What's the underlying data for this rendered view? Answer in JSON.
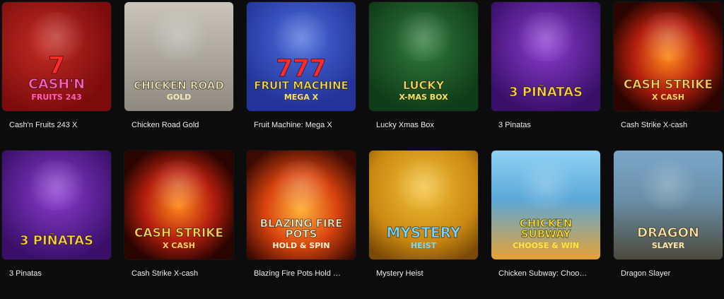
{
  "games": [
    {
      "title": "Cash'n Fruits 243 X",
      "art_text": [
        "7",
        "Cash'n",
        "Fruits 243"
      ],
      "icon": "slot-seven-fruit-art",
      "theme": "t-cash243",
      "text_color": "#ff5fb8",
      "text_size": 19
    },
    {
      "title": "Chicken Road Gold",
      "art_text": [
        "",
        "Chicken Road",
        "Gold"
      ],
      "icon": "chicken-mascot-art",
      "theme": "t-chicken",
      "text_color": "#f4e6b8",
      "text_size": 15
    },
    {
      "title": "Fruit Machine: Mega X",
      "art_text": [
        "777",
        "Fruit Machine",
        "Mega X"
      ],
      "icon": "fruit-machine-art",
      "theme": "t-fruitmx",
      "text_color": "#ffe04a",
      "text_size": 15
    },
    {
      "title": "Lucky Xmas Box",
      "art_text": [
        "",
        "Lucky",
        "X-Mas Box"
      ],
      "icon": "santa-art",
      "theme": "t-xmas",
      "text_color": "#ffdc5a",
      "text_size": 16
    },
    {
      "title": "3 Pinatas",
      "art_text": [
        "",
        "3 Piñatas",
        ""
      ],
      "icon": "pinata-cactus-art",
      "theme": "t-pinatas",
      "text_color": "#ffd23a",
      "text_size": 18
    },
    {
      "title": "Cash Strike X-cash",
      "art_text": [
        "",
        "Cash Strike",
        "X Cash"
      ],
      "icon": "cash-strike-art",
      "theme": "t-cashstrike",
      "text_color": "#ffd35a",
      "text_size": 17
    },
    {
      "title": "3 Pinatas",
      "art_text": [
        "",
        "3 Piñatas",
        ""
      ],
      "icon": "pinata-cactus-art",
      "theme": "t-pinatas",
      "text_color": "#ffd23a",
      "text_size": 18
    },
    {
      "title": "Cash Strike X-cash",
      "art_text": [
        "",
        "Cash Strike",
        "X Cash"
      ],
      "icon": "cash-strike-art",
      "theme": "t-cashstrike",
      "text_color": "#ffd35a",
      "text_size": 17
    },
    {
      "title": "Blazing Fire Pots Hold …",
      "art_text": [
        "",
        "Blazing Fire Pots",
        "Hold & Spin"
      ],
      "icon": "fire-pots-art",
      "theme": "t-blazing",
      "text_color": "#fff3d0",
      "text_size": 15
    },
    {
      "title": "Mystery Heist",
      "art_text": [
        "",
        "Mystery",
        "Heist"
      ],
      "icon": "masked-thief-art",
      "theme": "t-heist",
      "text_color": "#7ad6ff",
      "text_size": 20
    },
    {
      "title": "Chicken Subway: Choo…",
      "art_text": [
        "",
        "Chicken Subway",
        "Choose & Win"
      ],
      "icon": "chicken-train-art",
      "theme": "t-subway",
      "text_color": "#ffe23a",
      "text_size": 15
    },
    {
      "title": "Dragon Slayer",
      "art_text": [
        "",
        "Dragon",
        "Slayer"
      ],
      "icon": "dragon-art",
      "theme": "t-dragon",
      "text_color": "#ffe3a0",
      "text_size": 18
    }
  ]
}
